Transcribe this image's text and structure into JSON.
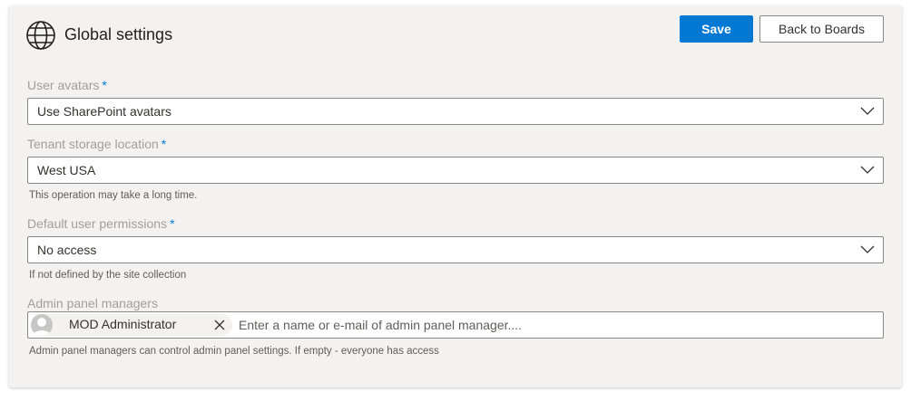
{
  "header": {
    "icon": "globe-icon",
    "title": "Global settings",
    "save_label": "Save",
    "back_label": "Back to Boards"
  },
  "colors": {
    "primary": "#0078d4",
    "required_marker": "#0078d4",
    "panel_background": "#f3f2f1"
  },
  "fields": {
    "user_avatars": {
      "label": "User avatars",
      "required": "*",
      "value": "Use SharePoint avatars"
    },
    "tenant_storage": {
      "label": "Tenant storage location",
      "required": "*",
      "value": "West USA",
      "hint": "This operation may take a long time."
    },
    "default_permissions": {
      "label": "Default user permissions",
      "required": "*",
      "value": "No access",
      "hint": "If not defined by the site collection"
    },
    "admin_managers": {
      "label": "Admin panel managers",
      "selected": [
        "MOD Administrator"
      ],
      "placeholder": "Enter a name or e-mail of admin panel manager....",
      "hint": "Admin panel managers can control admin panel settings. If empty - everyone has access"
    }
  }
}
